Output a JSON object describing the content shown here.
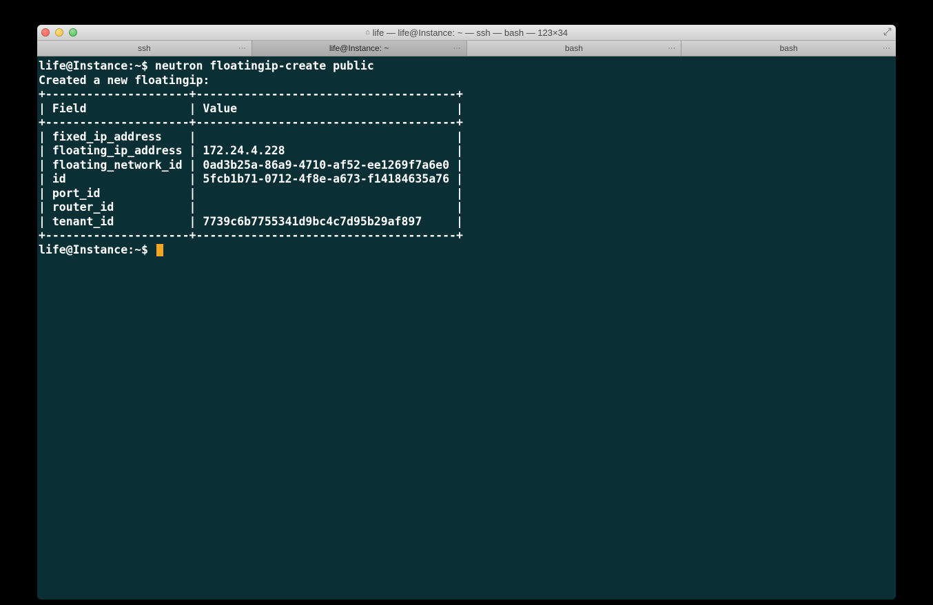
{
  "window": {
    "title": "life — life@Instance: ~ — ssh — bash — 123×34",
    "home_glyph": "⌂"
  },
  "tabs": [
    {
      "label": "ssh",
      "ell": "···",
      "active": false
    },
    {
      "label": "life@Instance: ~",
      "ell": "···",
      "active": true
    },
    {
      "label": "bash",
      "ell": "···",
      "active": false
    },
    {
      "label": "bash",
      "ell": "···",
      "active": false
    }
  ],
  "terminal": {
    "prompt": "life@Instance:~$ ",
    "command": "neutron floatingip-create public",
    "result_header": "Created a new floatingip:",
    "table": {
      "sep_top": "+---------------------+--------------------------------------+",
      "header": "| Field               | Value                                |",
      "sep_mid": "+---------------------+--------------------------------------+",
      "rows": [
        "| fixed_ip_address    |                                      |",
        "| floating_ip_address | 172.24.4.228                         |",
        "| floating_network_id | 0ad3b25a-86a9-4710-af52-ee1269f7a6e0 |",
        "| id                  | 5fcb1b71-0712-4f8e-a673-f14184635a76 |",
        "| port_id             |                                      |",
        "| router_id           |                                      |",
        "| tenant_id           | 7739c6b7755341d9bc4c7d95b29af897     |"
      ],
      "sep_bot": "+---------------------+--------------------------------------+"
    },
    "prompt2": "life@Instance:~$ "
  },
  "table_data": {
    "fixed_ip_address": "",
    "floating_ip_address": "172.24.4.228",
    "floating_network_id": "0ad3b25a-86a9-4710-af52-ee1269f7a6e0",
    "id": "5fcb1b71-0712-4f8e-a673-f14184635a76",
    "port_id": "",
    "router_id": "",
    "tenant_id": "7739c6b7755341d9bc4c7d95b29af897"
  }
}
